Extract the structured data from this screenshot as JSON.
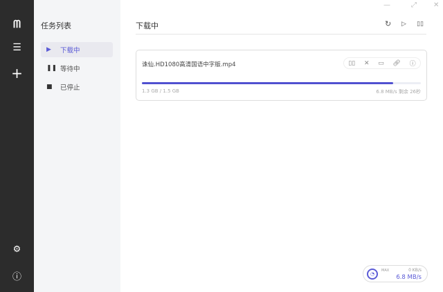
{
  "sidebar": {
    "icons": [
      "logo-icon",
      "task-list-icon",
      "add-task-icon",
      "preferences-icon",
      "help-icon"
    ]
  },
  "subnav": {
    "title": "任务列表",
    "items": [
      {
        "label": "下载中",
        "active": true
      },
      {
        "label": "等待中"
      },
      {
        "label": "已停止"
      }
    ]
  },
  "main": {
    "title": "下载中"
  },
  "task": {
    "name": "诛仙.HD1080高清国语中字版.mp4",
    "progress": 0.9,
    "size": "1.3 GB / 1.5 GB",
    "speed": "6.8 MB/s",
    "remaining": "剩余 26秒"
  },
  "speedometer": {
    "max_label": "MAX",
    "upload": "0 KB/s",
    "download": "6.8 MB/s"
  },
  "colors": {
    "accent": "#5b5bd6",
    "sidebar": "#2c2c2c"
  }
}
